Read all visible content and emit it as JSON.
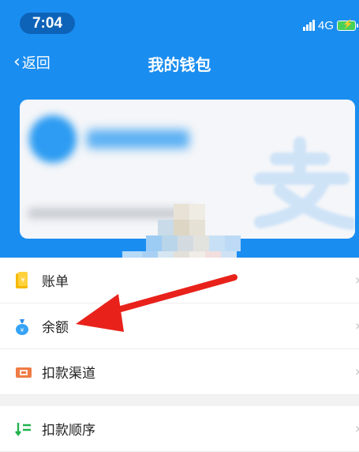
{
  "status_bar": {
    "time": "7:04",
    "network": "4G"
  },
  "nav": {
    "back_label": "返回",
    "title": "我的钱包"
  },
  "card": {
    "watermark_icon": "alipay-logo-icon"
  },
  "menu": {
    "items": [
      {
        "label": "账单",
        "icon": "bill-icon"
      },
      {
        "label": "余额",
        "icon": "balance-bag-icon"
      },
      {
        "label": "扣款渠道",
        "icon": "ticket-icon"
      }
    ],
    "section2": [
      {
        "label": "扣款顺序",
        "icon": "sort-order-icon"
      }
    ]
  },
  "colors": {
    "header_blue": "#1a8df0",
    "annotation_red": "#e8221b"
  }
}
